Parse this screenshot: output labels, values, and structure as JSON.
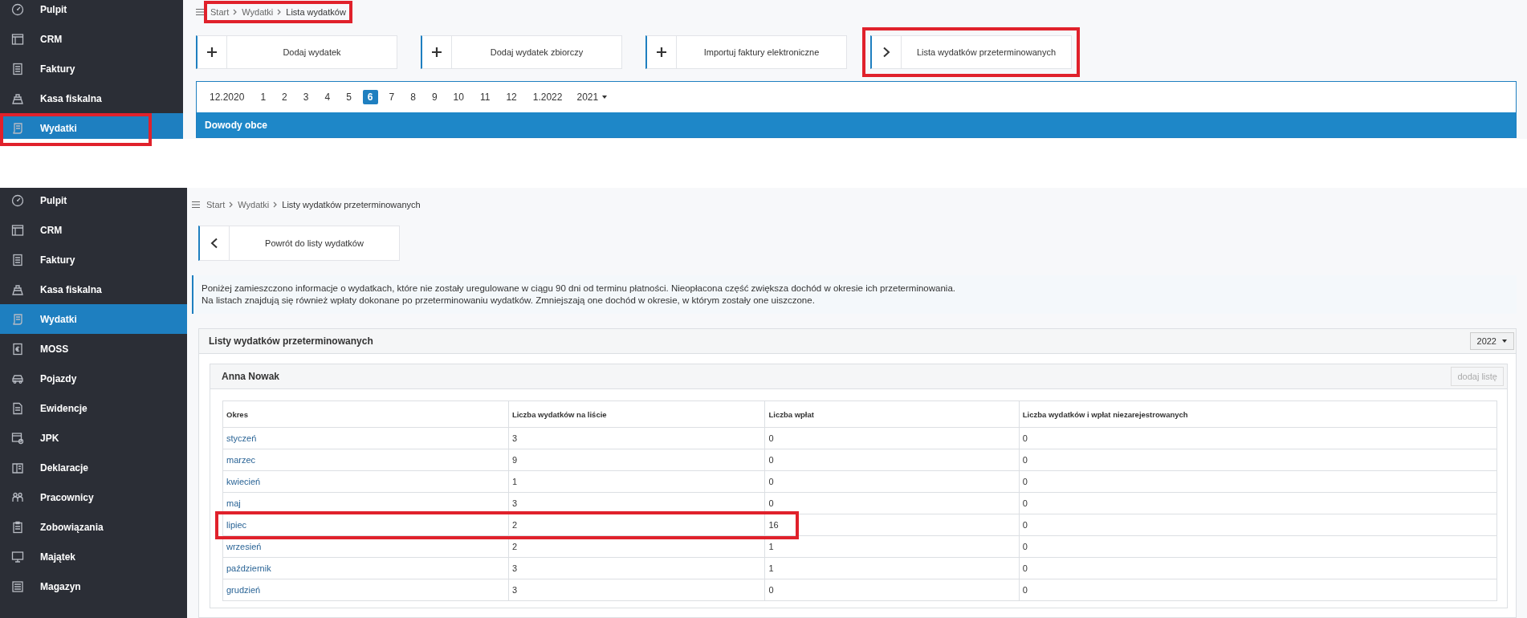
{
  "top_view": {
    "sidebar": {
      "items": [
        {
          "label": "Pulpit",
          "selected": false,
          "highlighted": false
        },
        {
          "label": "CRM",
          "selected": false,
          "highlighted": false
        },
        {
          "label": "Faktury",
          "selected": false,
          "highlighted": false
        },
        {
          "label": "Kasa fiskalna",
          "selected": false,
          "highlighted": false
        },
        {
          "label": "Wydatki",
          "selected": true,
          "highlighted": true
        }
      ]
    },
    "breadcrumb": {
      "items": [
        "Start",
        "Wydatki",
        "Lista wydatków"
      ],
      "highlighted": true
    },
    "action_buttons": [
      {
        "kind": "add",
        "label": "Dodaj wydatek",
        "highlighted": false
      },
      {
        "kind": "add",
        "label": "Dodaj wydatek zbiorczy",
        "highlighted": false
      },
      {
        "kind": "add",
        "label": "Importuj faktury elektroniczne",
        "highlighted": false
      },
      {
        "kind": "link",
        "label": "Lista wydatków przeterminowanych",
        "highlighted": true
      }
    ],
    "month_pager": {
      "items": [
        {
          "label": "12.2020",
          "selected": false
        },
        {
          "label": "1",
          "selected": false
        },
        {
          "label": "2",
          "selected": false
        },
        {
          "label": "3",
          "selected": false
        },
        {
          "label": "4",
          "selected": false
        },
        {
          "label": "5",
          "selected": false
        },
        {
          "label": "6",
          "selected": true
        },
        {
          "label": "7",
          "selected": false
        },
        {
          "label": "8",
          "selected": false
        },
        {
          "label": "9",
          "selected": false
        },
        {
          "label": "10",
          "selected": false
        },
        {
          "label": "11",
          "selected": false
        },
        {
          "label": "12",
          "selected": false
        },
        {
          "label": "1.2022",
          "selected": false
        }
      ],
      "year": "2021"
    },
    "section_title": "Dowody obce"
  },
  "bottom_view": {
    "sidebar": {
      "items": [
        {
          "label": "Pulpit",
          "selected": false
        },
        {
          "label": "CRM",
          "selected": false
        },
        {
          "label": "Faktury",
          "selected": false
        },
        {
          "label": "Kasa fiskalna",
          "selected": false
        },
        {
          "label": "Wydatki",
          "selected": true
        },
        {
          "label": "MOSS",
          "selected": false
        },
        {
          "label": "Pojazdy",
          "selected": false
        },
        {
          "label": "Ewidencje",
          "selected": false
        },
        {
          "label": "JPK",
          "selected": false
        },
        {
          "label": "Deklaracje",
          "selected": false
        },
        {
          "label": "Pracownicy",
          "selected": false
        },
        {
          "label": "Zobowiązania",
          "selected": false
        },
        {
          "label": "Majątek",
          "selected": false
        },
        {
          "label": "Magazyn",
          "selected": false
        }
      ]
    },
    "breadcrumb": {
      "items": [
        "Start",
        "Wydatki",
        "Listy wydatków przeterminowanych"
      ]
    },
    "back_button": {
      "label": "Powrót do listy wydatków"
    },
    "info": [
      "Poniżej zamieszczono informacje o wydatkach, które nie zostały uregulowane w ciągu 90 dni od terminu płatności. Nieopłacona część zwiększa dochód w okresie ich przeterminowania.",
      "Na listach znajdują się również wpłaty dokonane po przeterminowaniu wydatków. Zmniejszają one dochód w okresie, w którym zostały one uiszczone."
    ],
    "panel": {
      "title": "Listy wydatków przeterminowanych",
      "year": "2022",
      "card": {
        "title": "Anna Nowak",
        "add_button": {
          "label": "dodaj listę",
          "disabled": true
        },
        "table": {
          "columns": [
            "Okres",
            "Liczba wydatków na liście",
            "Liczba wpłat",
            "Liczba wydatków i wpłat niezarejestrowanych"
          ],
          "rows": [
            {
              "cells": [
                "styczeń",
                "3",
                "0",
                "0"
              ],
              "highlighted": false
            },
            {
              "cells": [
                "marzec",
                "9",
                "0",
                "0"
              ],
              "highlighted": false
            },
            {
              "cells": [
                "kwiecień",
                "1",
                "0",
                "0"
              ],
              "highlighted": false
            },
            {
              "cells": [
                "maj",
                "3",
                "0",
                "0"
              ],
              "highlighted": false
            },
            {
              "cells": [
                "lipiec",
                "2",
                "16",
                "0"
              ],
              "highlighted": true
            },
            {
              "cells": [
                "wrzesień",
                "2",
                "1",
                "0"
              ],
              "highlighted": false
            },
            {
              "cells": [
                "październik",
                "3",
                "1",
                "0"
              ],
              "highlighted": false
            },
            {
              "cells": [
                "grudzień",
                "3",
                "0",
                "0"
              ],
              "highlighted": false
            }
          ]
        }
      }
    }
  }
}
